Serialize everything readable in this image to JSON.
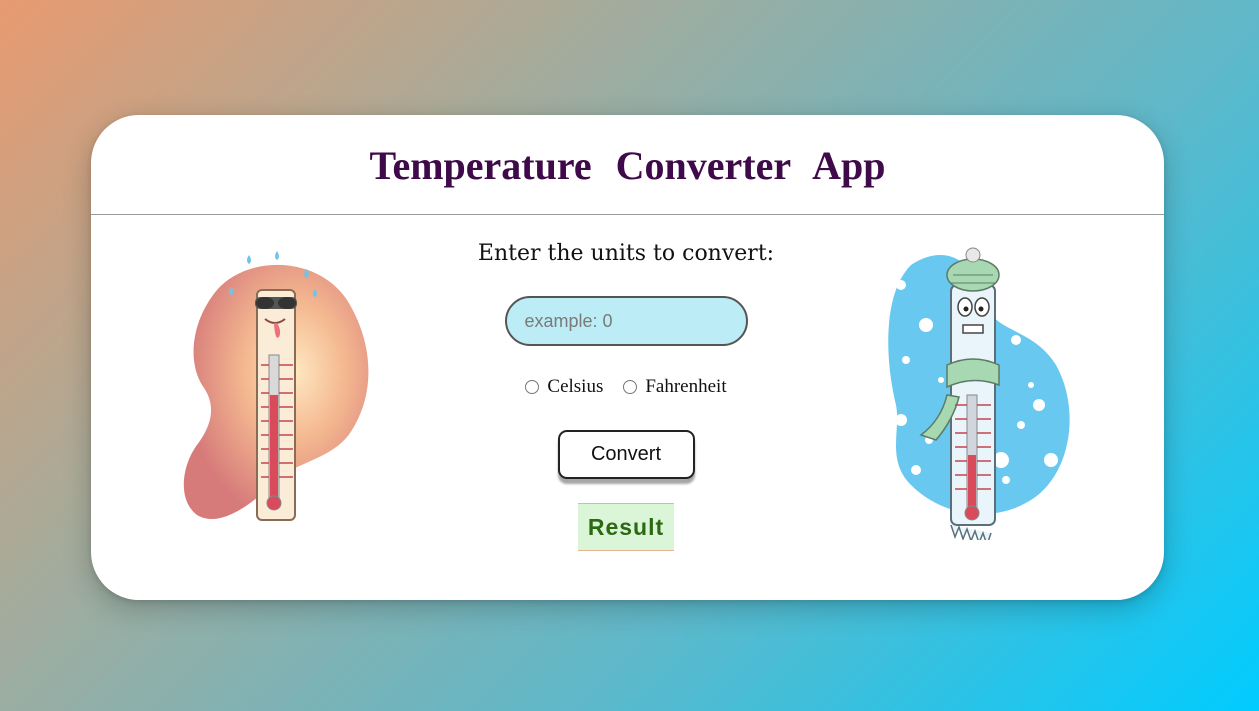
{
  "app": {
    "title": "Temperature  Converter  App"
  },
  "form": {
    "prompt": "Enter the units to convert:",
    "input_placeholder": "example: 0",
    "input_value": "",
    "units": [
      {
        "label": "Celsius",
        "checked": false
      },
      {
        "label": "Fahrenheit",
        "checked": false
      }
    ],
    "convert_label": "Convert",
    "result_label": "Result"
  },
  "images": {
    "hot": "thermometer-hot-icon",
    "cold": "thermometer-cold-icon"
  },
  "colors": {
    "title": "#3f0a4a",
    "input_bg": "#bcecf5",
    "result_bg": "#dbf5d9",
    "result_text": "#2c6a12"
  }
}
